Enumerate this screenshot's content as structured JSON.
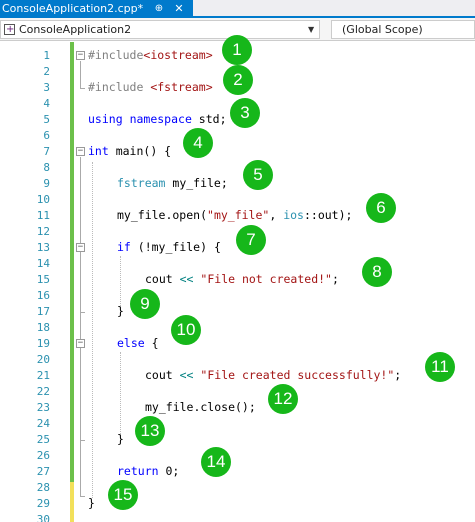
{
  "tab": {
    "title": "ConsoleApplication2.cpp*",
    "pin_icon": "pin-icon",
    "close_icon": "close-icon"
  },
  "nav": {
    "project": "ConsoleApplication2",
    "scope": "(Global Scope)"
  },
  "colors": {
    "accent": "#007acc",
    "badge": "#16b71a",
    "change_saved": "#6cc04a",
    "change_unsaved": "#f2e05a"
  },
  "line_numbers": [
    "1",
    "2",
    "3",
    "4",
    "5",
    "6",
    "7",
    "8",
    "9",
    "10",
    "11",
    "12",
    "13",
    "14",
    "15",
    "16",
    "17",
    "18",
    "19",
    "20",
    "21",
    "22",
    "23",
    "24",
    "25",
    "26",
    "27",
    "28",
    "29",
    "30"
  ],
  "code": {
    "l1": {
      "kw": "#include",
      "arg": "<iostream>"
    },
    "l3": {
      "kw": "#include ",
      "arg": "<fstream>"
    },
    "l5": {
      "k1": "using",
      "sp": " ",
      "k2": "namespace",
      "rest": " std;"
    },
    "l7": {
      "kw": "int",
      "rest": " main() {"
    },
    "l9": {
      "type": "fstream",
      "rest": " my_file;"
    },
    "l11": {
      "pre": "my_file.open(",
      "str": "\"my_file\"",
      "mid": ", ",
      "type": "ios",
      "post": "::out);"
    },
    "l13": {
      "kw": "if",
      "rest": " (!my_file) {"
    },
    "l15": {
      "pre": "cout ",
      "op": "<<",
      "sp": " ",
      "str": "\"File not created!\"",
      "post": ";"
    },
    "l17": {
      "text": "}"
    },
    "l19": {
      "kw": "else",
      "rest": " {"
    },
    "l21": {
      "pre": "cout ",
      "op": "<<",
      "sp": " ",
      "str": "\"File created successfully!\"",
      "post": ";"
    },
    "l23": {
      "text": "my_file.close();"
    },
    "l25": {
      "text": "}"
    },
    "l27": {
      "kw": "return",
      "rest": " 0;"
    },
    "l29": {
      "text": "}"
    }
  },
  "badges": [
    "1",
    "2",
    "3",
    "4",
    "5",
    "6",
    "7",
    "8",
    "9",
    "10",
    "11",
    "12",
    "13",
    "14",
    "15"
  ]
}
